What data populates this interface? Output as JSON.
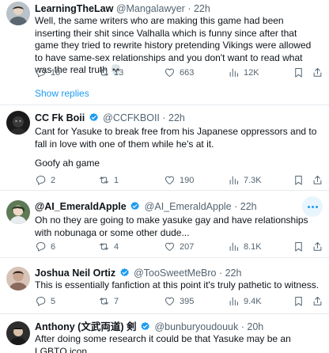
{
  "tweets": [
    {
      "name": "LearningTheLaw",
      "handle": "@Mangalawyer",
      "time": "22h",
      "text": "Well, the same writers who are making this game had been inserting their shit since Valhalla which is funny since after that game they tried to rewrite history pretending Vikings were allowed to have same-sex relationships and you don't want to read what was the real truth 💀",
      "replies": "10",
      "reposts": "13",
      "likes": "663",
      "views": "12K"
    },
    {
      "name": "CC Fk Boii",
      "handle": "@CCFKBOII",
      "time": "22h",
      "verified": true,
      "text": "Cant for Yasuke to break free from his Japanese oppressors and to fall in love with one of them while he's at it.",
      "text2": "Goofy ah game",
      "replies": "2",
      "reposts": "1",
      "likes": "190",
      "views": "7.3K"
    },
    {
      "name": "@AI_EmeraldApple",
      "handle": "@AI_EmeraldApple",
      "time": "22h",
      "verified": true,
      "text": "Oh no they are going to make yasuke gay and have relationships with nobunaga or some other dude...",
      "replies": "6",
      "reposts": "4",
      "likes": "207",
      "views": "8.1K"
    },
    {
      "name": "Joshua Neil Ortiz",
      "handle": "@TooSweetMeBro",
      "time": "22h",
      "verified": true,
      "text": "This is essentially fanfiction at this point it's truly pathetic to witness.",
      "replies": "5",
      "reposts": "7",
      "likes": "395",
      "views": "9.4K"
    },
    {
      "name": "Anthony (文武両道) 剣",
      "handle": "@bunburyoudouuk",
      "time": "20h",
      "verified": true,
      "text": "After doing some research it could be that Yasuke may be an LGBTQ icon."
    }
  ],
  "show_replies": "Show replies",
  "colors": {
    "accent": "#1d9bf0",
    "muted": "#536471",
    "text": "#0f1419"
  },
  "icons": [
    "reply-icon",
    "repost-icon",
    "like-icon",
    "views-icon",
    "bookmark-icon",
    "share-icon",
    "verified-icon",
    "more-icon"
  ]
}
